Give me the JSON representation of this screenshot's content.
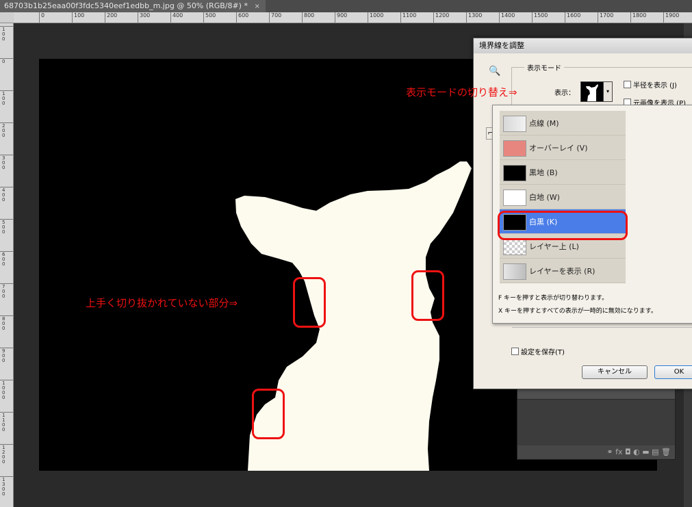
{
  "tab": {
    "title": "68703b1b25eaa00f3fdc5340eef1edbb_m.jpg @ 50% (RGB/8#) *",
    "close": "×"
  },
  "ruler": {
    "h_labels": [
      "00",
      "0",
      "100",
      "200",
      "300",
      "400",
      "500",
      "600",
      "700",
      "800",
      "900",
      "1000",
      "1100",
      "1200",
      "1300",
      "1400",
      "1500",
      "1600",
      "1700",
      "1800",
      "1900"
    ],
    "v_labels": [
      "100",
      "0",
      "100",
      "200",
      "300",
      "400",
      "500",
      "600",
      "700",
      "800",
      "900",
      "1000",
      "1100",
      "1200",
      "1300"
    ]
  },
  "dialog": {
    "title": "境界線を調整",
    "group_label": "表示モード",
    "display_label": "表示：",
    "radius_checkbox": "半径を表示 (J)",
    "original_checkbox": "元画像を表示 (P)",
    "save_checkbox": "設定を保存(T)",
    "cancel_label": "キャンセル",
    "ok_label": "OK"
  },
  "view_menu": {
    "items": [
      {
        "label": "点線 (M)",
        "thumb": "marching-ants",
        "selected": false
      },
      {
        "label": "オーバーレイ (V)",
        "thumb": "overlay",
        "selected": false
      },
      {
        "label": "黒地 (B)",
        "thumb": "on-black",
        "selected": false
      },
      {
        "label": "白地 (W)",
        "thumb": "on-white",
        "selected": false
      },
      {
        "label": "白黒 (K)",
        "thumb": "black-white",
        "selected": true
      },
      {
        "label": "レイヤー上 (L)",
        "thumb": "on-layers",
        "selected": false
      },
      {
        "label": "レイヤーを表示 (R)",
        "thumb": "reveal-layer",
        "selected": false
      }
    ],
    "hint_f": "F キーを押すと表示が切り替わります。",
    "hint_x": "X キーを押すとすべての表示が一時的に無効になります。"
  },
  "annotations": {
    "mode_switch": "表示モードの切り替え⇒",
    "bad_cut": "上手く切り抜かれていない部分⇒"
  },
  "colors": {
    "highlight": "#e11111",
    "selected": "#4a7de8",
    "subject": "#fdfbee"
  }
}
